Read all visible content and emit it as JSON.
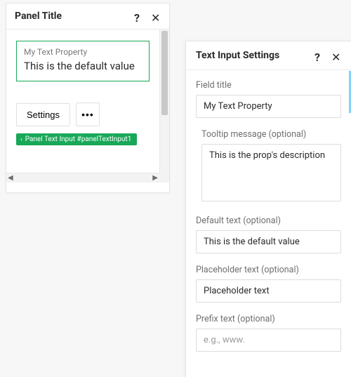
{
  "panel": {
    "title": "Panel Title",
    "field_label": "My Text Property",
    "field_value": "This is the default value",
    "settings_label": "Settings",
    "more_label": "•••",
    "badge_text": "Panel Text Input #panelTextInput1"
  },
  "settings": {
    "title": "Text Input Settings",
    "fields": {
      "field_title": {
        "label": "Field title",
        "value": "My Text Property"
      },
      "tooltip": {
        "label": "Tooltip message (optional)",
        "value": "This is the prop's description"
      },
      "default_text": {
        "label": "Default text (optional)",
        "value": "This is the default value"
      },
      "placeholder_text": {
        "label": "Placeholder text (optional)",
        "value": "Placeholder text"
      },
      "prefix_text": {
        "label": "Prefix text (optional)",
        "placeholder": "e.g., www."
      }
    }
  },
  "icons": {
    "help": "?",
    "close": "✕",
    "chevron_left": "‹",
    "arrow_left": "◀",
    "arrow_right": "▶"
  }
}
